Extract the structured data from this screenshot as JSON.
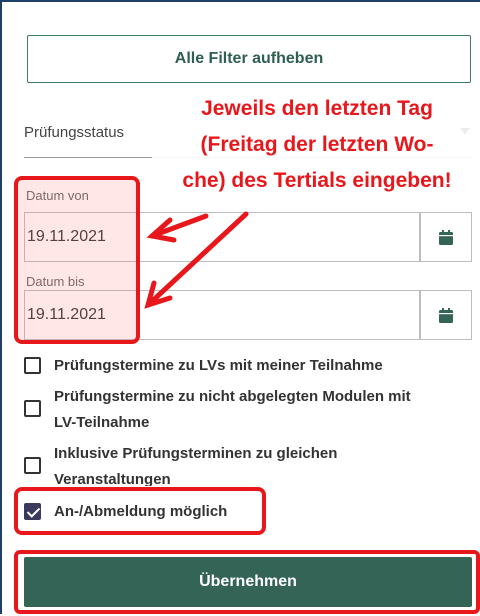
{
  "filters": {
    "clear_label": "Alle Filter aufheben",
    "status_label": "Prüfungsstatus",
    "date_from_label": "Datum von",
    "date_from_value": "19.11.2021",
    "date_to_label": "Datum bis",
    "date_to_value": "19.11.2021",
    "checkboxes": [
      {
        "label": "Prüfungstermine zu LVs mit meiner Teilnahme",
        "checked": false
      },
      {
        "label_line1": "Prüfungstermine zu nicht abgelegten Modulen mit",
        "label_line2": "LV-Teilnahme",
        "checked": false
      },
      {
        "label_line1": "Inklusive Prüfungsterminen zu gleichen",
        "label_line2": "Veranstaltungen",
        "checked": false
      },
      {
        "label": "An-/Abmeldung möglich",
        "checked": true
      }
    ],
    "submit_label": "Übernehmen"
  },
  "annotation": {
    "line1": "Jeweils den letzten Tag",
    "line2": "(Freitag der letzten Wo-",
    "line3": "che) des Tertials eingeben!",
    "color": "#e8171b"
  },
  "icons": {
    "calendar": "calendar-icon",
    "caret": "chevron-down-icon",
    "check": "check-icon"
  },
  "colors": {
    "primary": "#336456",
    "accent_red": "#e8171b",
    "checkbox_checked": "#3b3a5e"
  }
}
